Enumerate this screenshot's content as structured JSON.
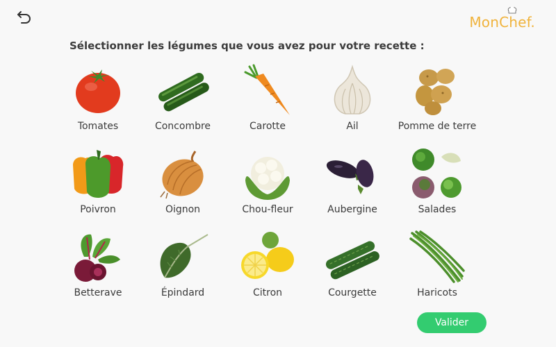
{
  "header": {
    "back_icon": "undo-arrow-icon",
    "logo_text": "MonChef.",
    "logo_color": "#f0b33c"
  },
  "prompt": "Sélectionner les légumes que vous avez pour votre recette :",
  "vegetables": [
    {
      "label": "Tomates",
      "icon": "tomato-icon"
    },
    {
      "label": "Concombre",
      "icon": "cucumber-icon"
    },
    {
      "label": "Carotte",
      "icon": "carrot-icon"
    },
    {
      "label": "Ail",
      "icon": "garlic-icon"
    },
    {
      "label": "Pomme de terre",
      "icon": "potato-icon"
    },
    {
      "label": "Poivron",
      "icon": "bell-pepper-icon"
    },
    {
      "label": "Oignon",
      "icon": "onion-icon"
    },
    {
      "label": "Chou-fleur",
      "icon": "cauliflower-icon"
    },
    {
      "label": "Aubergine",
      "icon": "eggplant-icon"
    },
    {
      "label": "Salades",
      "icon": "lettuce-icon"
    },
    {
      "label": "Betterave",
      "icon": "beetroot-icon"
    },
    {
      "label": "Épindard",
      "icon": "spinach-icon"
    },
    {
      "label": "Citron",
      "icon": "lemon-icon"
    },
    {
      "label": "Courgette",
      "icon": "zucchini-icon"
    },
    {
      "label": "Haricots",
      "icon": "green-beans-icon"
    }
  ],
  "validate_button": {
    "label": "Valider",
    "color": "#33cc70"
  }
}
